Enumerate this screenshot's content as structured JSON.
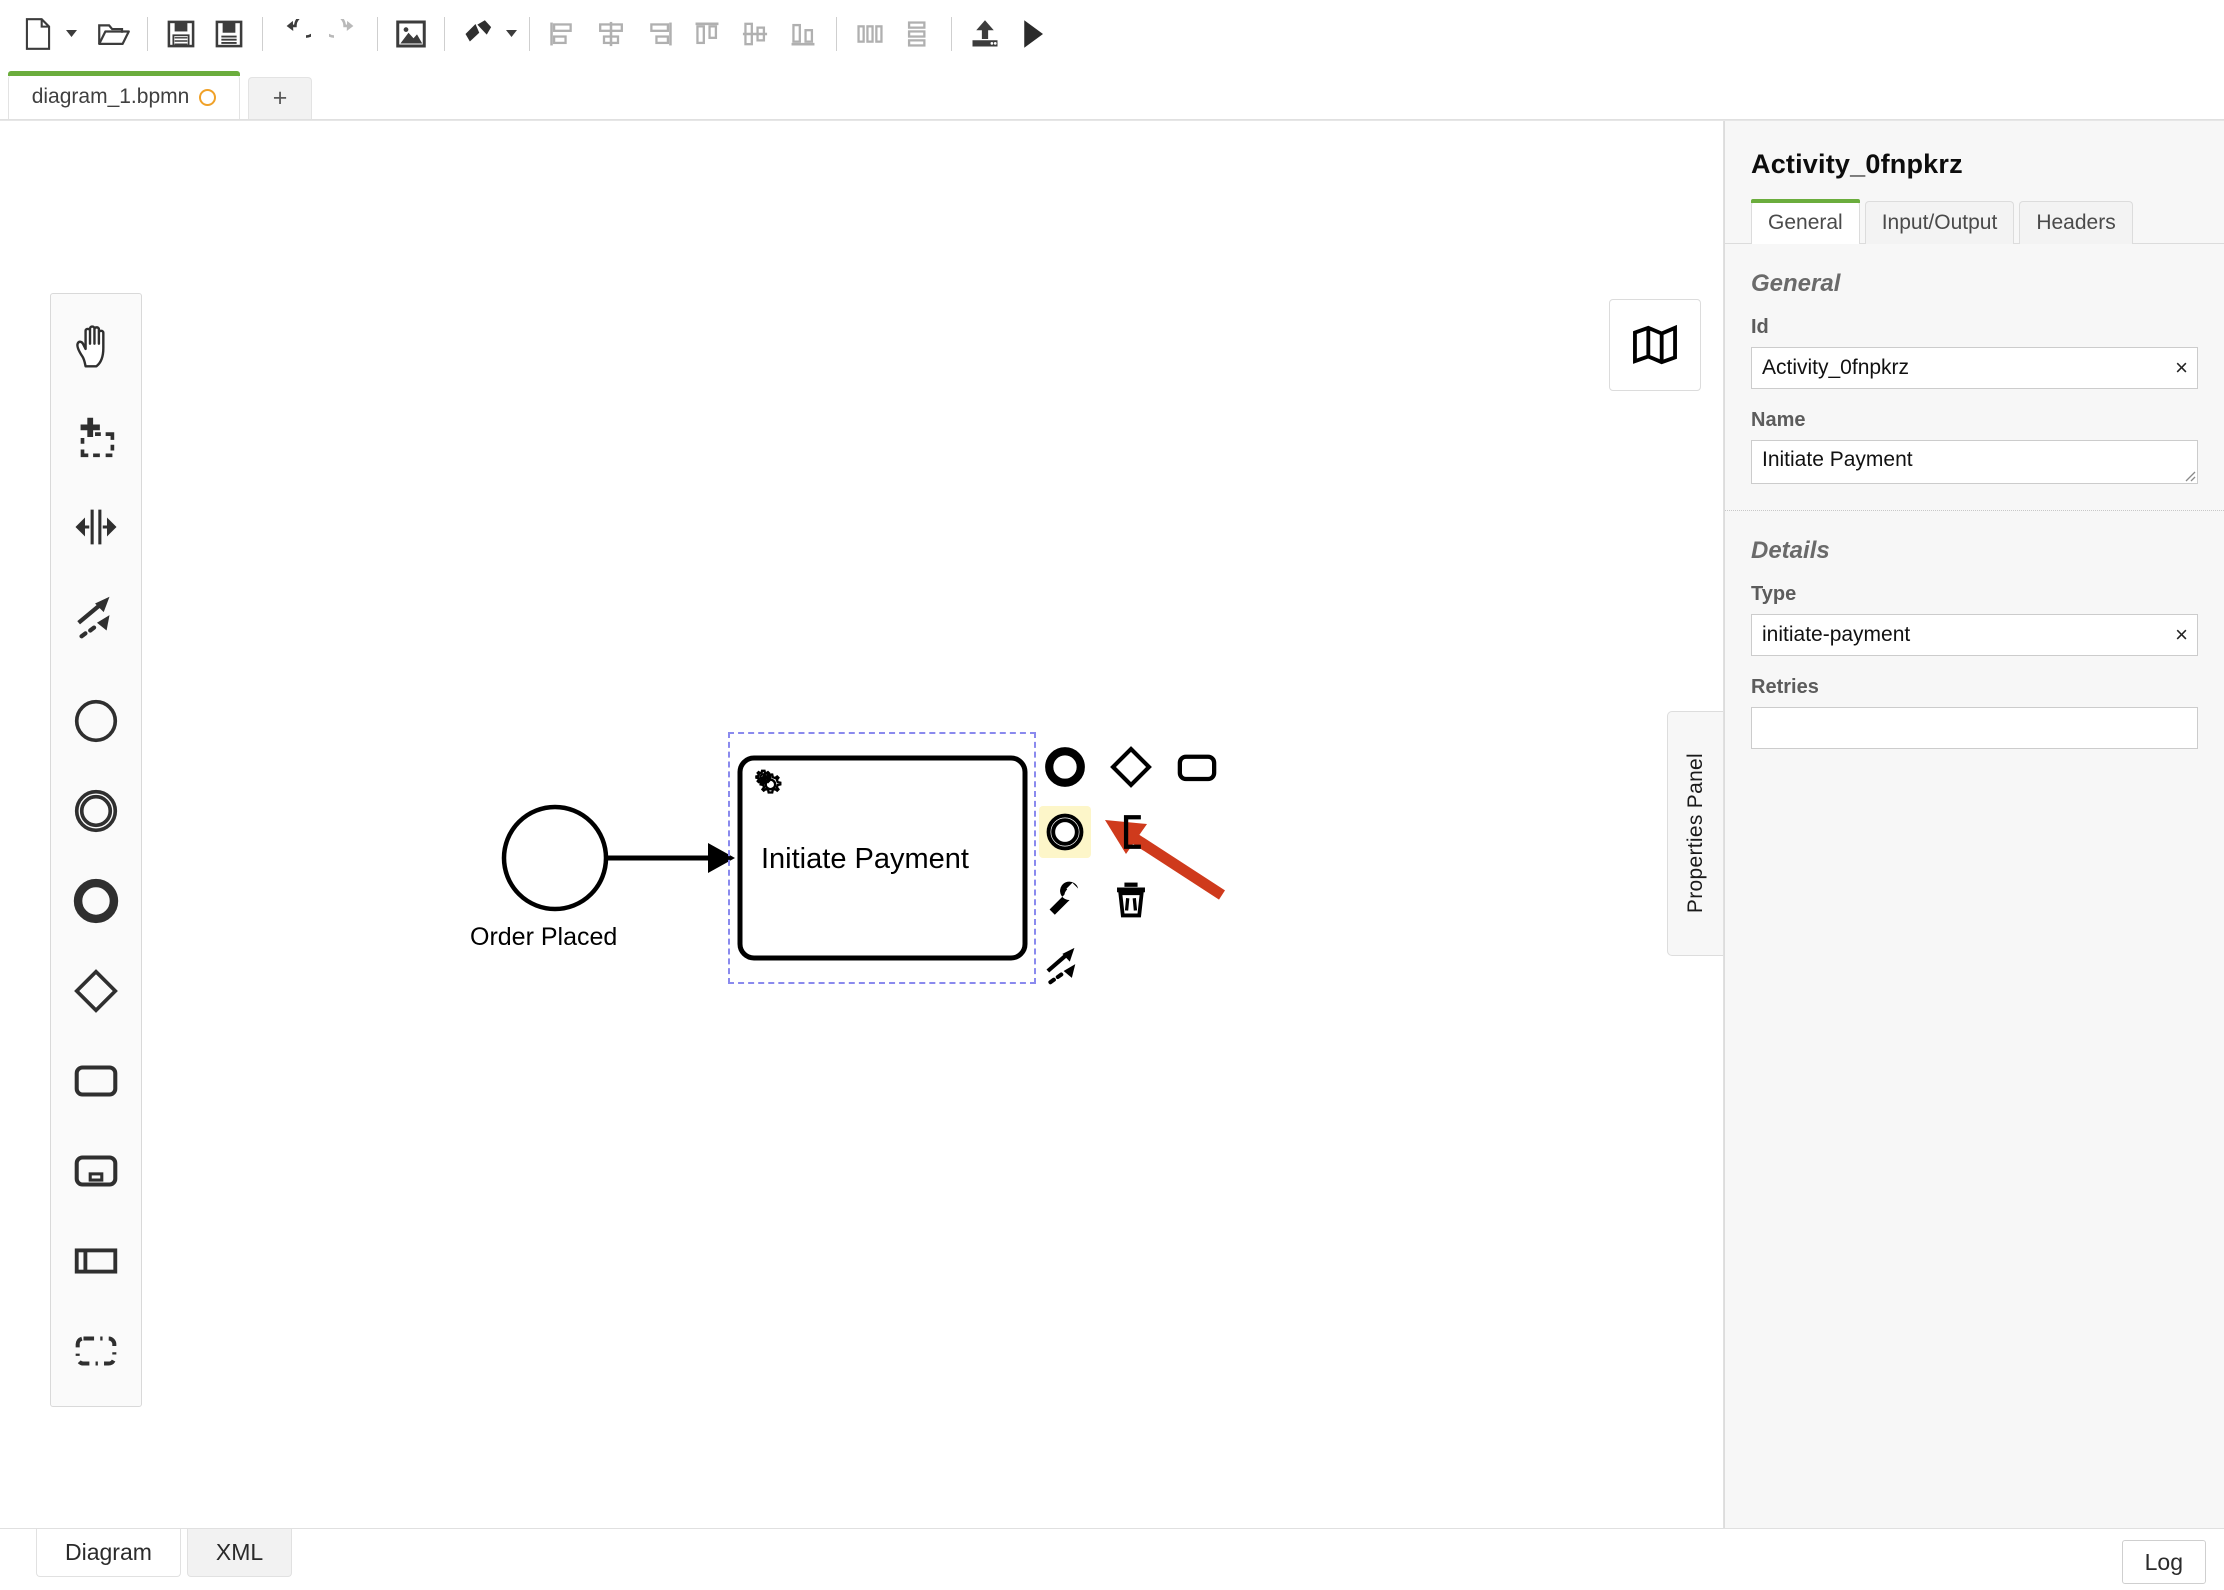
{
  "toolbar": {
    "items": [
      {
        "name": "new-diagram-button",
        "icon": "new-file-icon",
        "label": "New",
        "enabled": true,
        "has_caret": true
      },
      {
        "name": "open-diagram-button",
        "icon": "open-folder-icon",
        "label": "Open",
        "enabled": true
      },
      {
        "name": "save-diagram-button",
        "icon": "save-icon",
        "label": "Save",
        "enabled": true
      },
      {
        "name": "save-as-button",
        "icon": "save-as-icon",
        "label": "Save As",
        "enabled": true
      },
      {
        "name": "undo-button",
        "icon": "undo-icon",
        "label": "Undo",
        "enabled": true
      },
      {
        "name": "redo-button",
        "icon": "redo-icon",
        "label": "Redo",
        "enabled": false
      },
      {
        "name": "export-image-button",
        "icon": "image-export-icon",
        "label": "Export as image",
        "enabled": true
      },
      {
        "name": "color-picker-button",
        "icon": "paint-brush-icon",
        "label": "Set color",
        "enabled": true,
        "has_caret": true
      },
      {
        "name": "align-left-button",
        "icon": "align-left-icon",
        "label": "Align left",
        "enabled": false
      },
      {
        "name": "align-center-button",
        "icon": "align-center-icon",
        "label": "Align center",
        "enabled": false
      },
      {
        "name": "align-right-button",
        "icon": "align-right-icon",
        "label": "Align right",
        "enabled": false
      },
      {
        "name": "align-top-button",
        "icon": "align-top-icon",
        "label": "Align top",
        "enabled": false
      },
      {
        "name": "align-middle-button",
        "icon": "align-middle-icon",
        "label": "Align middle",
        "enabled": false
      },
      {
        "name": "align-bottom-button",
        "icon": "align-bottom-icon",
        "label": "Align bottom",
        "enabled": false
      },
      {
        "name": "distribute-horizontal-button",
        "icon": "distribute-horizontal-icon",
        "label": "Distribute horizontally",
        "enabled": false
      },
      {
        "name": "distribute-vertical-button",
        "icon": "distribute-vertical-icon",
        "label": "Distribute vertically",
        "enabled": false
      },
      {
        "name": "deploy-button",
        "icon": "deploy-upload-icon",
        "label": "Deploy",
        "enabled": true
      },
      {
        "name": "run-button",
        "icon": "play-icon",
        "label": "Run",
        "enabled": true
      }
    ]
  },
  "tabbar": {
    "document_tab": {
      "filename": "diagram_1.bpmn",
      "unsaved_indicator": "unsaved-dot",
      "unsaved_color": "#f0a128",
      "active_color": "#6bad3d"
    },
    "add_tab_label": "+"
  },
  "palette": {
    "groups": [
      {
        "items": [
          {
            "name": "palette-hand-tool",
            "icon": "hand-tool-icon",
            "label": "Activate hand tool"
          },
          {
            "name": "palette-lasso-tool",
            "icon": "lasso-tool-icon",
            "label": "Activate lasso tool"
          },
          {
            "name": "palette-space-tool",
            "icon": "space-tool-icon",
            "label": "Activate create/remove space tool"
          },
          {
            "name": "palette-global-connect-tool",
            "icon": "global-connect-icon",
            "label": "Activate global connect tool"
          }
        ]
      },
      {
        "items": [
          {
            "name": "palette-start-event",
            "icon": "start-event-icon",
            "label": "Create start event"
          },
          {
            "name": "palette-intermediate-event",
            "icon": "intermediate-event-icon",
            "label": "Create intermediate/boundary event"
          },
          {
            "name": "palette-end-event",
            "icon": "end-event-icon",
            "label": "Create end event"
          },
          {
            "name": "palette-gateway",
            "icon": "gateway-icon",
            "label": "Create gateway"
          },
          {
            "name": "palette-task",
            "icon": "task-icon",
            "label": "Create task"
          },
          {
            "name": "palette-subprocess",
            "icon": "subprocess-expanded-icon",
            "label": "Create expanded subprocess"
          },
          {
            "name": "palette-participant",
            "icon": "participant-pool-icon",
            "label": "Create pool/participant"
          },
          {
            "name": "palette-group",
            "icon": "group-icon",
            "label": "Create group"
          }
        ]
      }
    ]
  },
  "canvas": {
    "minimap_toggle": {
      "name": "minimap-toggle-button",
      "icon": "map-icon",
      "label": "Toggle minimap"
    },
    "elements": [
      {
        "name": "start-event-order-placed",
        "type": "startEvent",
        "label": "Order Placed"
      },
      {
        "name": "service-task-initiate-payment",
        "type": "serviceTask",
        "label": "Initiate Payment",
        "marker": "gear-icon",
        "selected": true
      },
      {
        "name": "sequence-flow",
        "type": "sequenceFlow",
        "label": ""
      }
    ],
    "context_pad": {
      "items": [
        {
          "name": "append-end-event",
          "icon": "end-event-icon",
          "label": "Append end event",
          "hovered": false
        },
        {
          "name": "append-gateway",
          "icon": "gateway-icon",
          "label": "Append gateway",
          "hovered": false
        },
        {
          "name": "append-task",
          "icon": "task-icon",
          "label": "Append task",
          "hovered": false
        },
        {
          "name": "append-intermediate-event",
          "icon": "intermediate-event-icon",
          "label": "Append intermediate/boundary event",
          "hovered": true
        },
        {
          "name": "append-text-annotation",
          "icon": "text-annotation-icon",
          "label": "Append text annotation",
          "hovered": false
        },
        {
          "name": "change-element-type",
          "icon": "wrench-icon",
          "label": "Change element",
          "hovered": false
        },
        {
          "name": "delete-element",
          "icon": "trash-icon",
          "label": "Remove",
          "hovered": false
        },
        {
          "name": "connect-element",
          "icon": "connect-arrows-icon",
          "label": "Connect using sequence/message flow",
          "hovered": false
        }
      ],
      "highlight_color": "#fdf6c9"
    },
    "annotation_arrow": {
      "name": "red-pointer-arrow",
      "color": "#cf3a1c"
    }
  },
  "properties_panel_tab": {
    "label": "Properties Panel"
  },
  "properties": {
    "title": "Activity_0fnpkrz",
    "tabs": [
      {
        "name": "tab-general",
        "label": "General",
        "active": true
      },
      {
        "name": "tab-input-output",
        "label": "Input/Output",
        "active": false
      },
      {
        "name": "tab-headers",
        "label": "Headers",
        "active": false
      }
    ],
    "groups": [
      {
        "name": "group-general",
        "title": "General",
        "fields": [
          {
            "name": "field-id",
            "label": "Id",
            "value": "Activity_0fnpkrz",
            "placeholder": "",
            "clearable": true,
            "kind": "input"
          },
          {
            "name": "field-name",
            "label": "Name",
            "value": "Initiate Payment",
            "placeholder": "",
            "clearable": false,
            "kind": "textarea"
          }
        ]
      },
      {
        "name": "group-details",
        "title": "Details",
        "fields": [
          {
            "name": "field-type",
            "label": "Type",
            "value": "initiate-payment",
            "placeholder": "",
            "clearable": true,
            "kind": "input"
          },
          {
            "name": "field-retries",
            "label": "Retries",
            "value": "",
            "placeholder": "",
            "clearable": false,
            "kind": "input"
          }
        ]
      }
    ],
    "clear_icon": "×"
  },
  "statusbar": {
    "view_tabs": [
      {
        "name": "view-tab-diagram",
        "label": "Diagram",
        "active": true
      },
      {
        "name": "view-tab-xml",
        "label": "XML",
        "active": false
      }
    ],
    "log_button": {
      "name": "log-button",
      "label": "Log"
    }
  }
}
